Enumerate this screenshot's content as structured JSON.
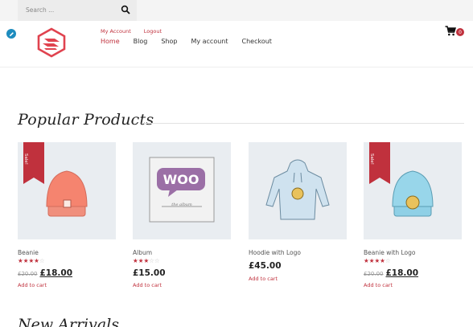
{
  "search": {
    "placeholder": "Search ..."
  },
  "header": {
    "account_links": [
      "My Account",
      "Logout"
    ],
    "nav": [
      "Home",
      "Blog",
      "Shop",
      "My account",
      "Checkout"
    ],
    "cart_count": "0"
  },
  "sections": {
    "popular": "Popular Products",
    "next": "New Arrivals"
  },
  "colors": {
    "accent": "#c0313d",
    "edit_badge": "#1e8cbe"
  },
  "products": [
    {
      "name": "Beanie",
      "sale_badge": "Sale!",
      "rating": 4,
      "old_price": "£20.00",
      "price": "£18.00",
      "action": "Add to cart"
    },
    {
      "name": "Album",
      "rating": 3,
      "price": "£15.00",
      "action": "Add to cart"
    },
    {
      "name": "Hoodie with Logo",
      "price": "£45.00",
      "action": "Add to cart"
    },
    {
      "name": "Beanie with Logo",
      "sale_badge": "Sale!",
      "rating": 4,
      "old_price": "£20.00",
      "price": "£18.00",
      "action": "Add to cart"
    }
  ]
}
